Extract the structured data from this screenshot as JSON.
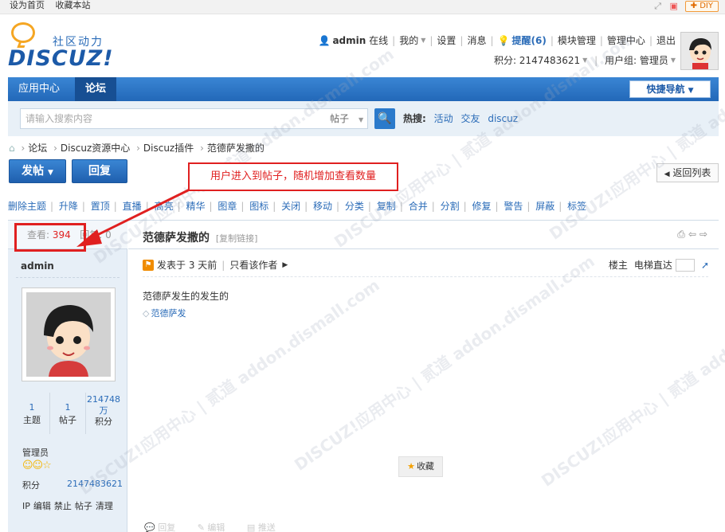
{
  "topbar": {
    "set_home": "设为首页",
    "bookmark": "收藏本站",
    "diy": "DIY"
  },
  "logo": {
    "cn": "社区动力",
    "en": "DISCUZ!"
  },
  "user": {
    "name": "admin",
    "online": "在线",
    "mine": "我的",
    "settings": "设置",
    "messages": "消息",
    "remind": "提醒(6)",
    "module_mgmt": "模块管理",
    "admin_center": "管理中心",
    "logout": "退出",
    "points_label": "积分: 2147483621",
    "group_label": "用户组: 管理员"
  },
  "nav": {
    "app_center": "应用中心",
    "forum": "论坛",
    "quick_nav": "快捷导航"
  },
  "search": {
    "placeholder": "请输入搜索内容",
    "type": "帖子",
    "hot_label": "热搜:",
    "hot": [
      "活动",
      "交友",
      "discuz"
    ]
  },
  "breadcrumb": [
    "论坛",
    "Discuz资源中心",
    "Discuz插件",
    "范德萨发撒的"
  ],
  "buttons": {
    "post": "发帖",
    "reply": "回复",
    "back_list": "返回列表"
  },
  "annotation": "用户进入到帖子，随机增加查看数量",
  "modbar": [
    "删除主题",
    "升降",
    "置顶",
    "直播",
    "高亮",
    "精华",
    "图章",
    "图标",
    "关闭",
    "移动",
    "分类",
    "复制",
    "合并",
    "分割",
    "修复",
    "警告",
    "屏蔽",
    "标签"
  ],
  "thread": {
    "views_label": "查看:",
    "views": "394",
    "replies_label": "回复:",
    "replies": "0",
    "title": "范德萨发撒的",
    "copy_link": "[复制链接]",
    "posted": "发表于 3 天前",
    "only_author": "只看该作者",
    "floor_owner": "楼主",
    "elevator": "电梯直达",
    "content": "范德萨发生的发生的",
    "tag": "范德萨发",
    "favorite": "收藏",
    "reply_action": "回复",
    "edit_action": "编辑",
    "promote_action": "推送"
  },
  "author": {
    "name": "admin",
    "threads": "1",
    "threads_label": "主题",
    "posts": "1",
    "posts_label": "帖子",
    "points_val": "214748万",
    "points_val_a": "214748",
    "points_val_b": "万",
    "points_label": "积分",
    "role": "管理员",
    "points_title": "积分",
    "points_full": "2147483621",
    "actions": [
      "IP",
      "编辑",
      "禁止",
      "帖子",
      "清理"
    ]
  },
  "watermark": "DISCUZ!应用中心 | 贰道 addon.dismall.com"
}
